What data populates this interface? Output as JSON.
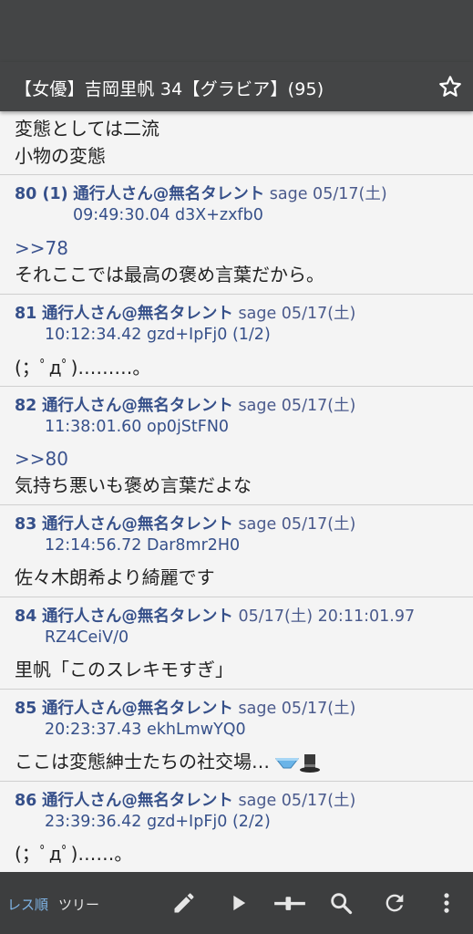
{
  "header": {
    "title": "【女優】吉岡里帆 34【グラビア】(95)",
    "star_icon": "star-outline-icon"
  },
  "partial_post": {
    "lines": [
      "変態としては二流",
      "小物の変態"
    ]
  },
  "posts": [
    {
      "num": "80 (1)",
      "name": "通行人さん@無名タレント",
      "meta": "sage 05/17(土)",
      "idline": "09:49:30.04 d3X+zxfb0",
      "lines": [
        ">>78",
        "それここでは最高の褒め言葉だから。"
      ]
    },
    {
      "num": "81",
      "name": "通行人さん@無名タレント",
      "meta": "sage 05/17(土)",
      "idline": "10:12:34.42 gzd+IpFj0 (1/2)",
      "lines": [
        "(；ﾟдﾟ)………。"
      ]
    },
    {
      "num": "82",
      "name": "通行人さん@無名タレント",
      "meta": "sage 05/17(土)",
      "idline": "11:38:01.60 op0jStFN0",
      "lines": [
        ">>80",
        "気持ち悪いも褒め言葉だよな"
      ]
    },
    {
      "num": "83",
      "name": "通行人さん@無名タレント",
      "meta": "sage 05/17(土)",
      "idline": "12:14:56.72 Dar8mr2H0",
      "lines": [
        "佐々木朗希より綺麗です"
      ]
    },
    {
      "num": "84",
      "name": "通行人さん@無名タレント",
      "meta": " 05/17(土) 20:11:01.97",
      "idline": "RZ4CeiV/0",
      "lines": [
        "里帆「このスレキモすぎ」"
      ]
    },
    {
      "num": "85",
      "name": "通行人さん@無名タレント",
      "meta": "sage 05/17(土)",
      "idline": "20:23:37.43 ekhLmwYQ0",
      "lines": [
        "ここは変態紳士たちの社交場…"
      ]
    },
    {
      "num": "86",
      "name": "通行人さん@無名タレント",
      "meta": "sage 05/17(土)",
      "idline": "23:39:36.42 gzd+IpFj0 (2/2)",
      "lines": [
        "(；ﾟдﾟ)……。"
      ]
    }
  ],
  "bottombar": {
    "tab_res_order": "レス順",
    "tab_tree": "ツリー",
    "icons": [
      "pencil-icon",
      "play-icon",
      "slider-icon",
      "search-icon",
      "refresh-icon",
      "more-vert-icon"
    ]
  },
  "colors": {
    "bar": "#444546",
    "anchor": "#3a528e",
    "accent_tab": "#7fb4e6"
  }
}
